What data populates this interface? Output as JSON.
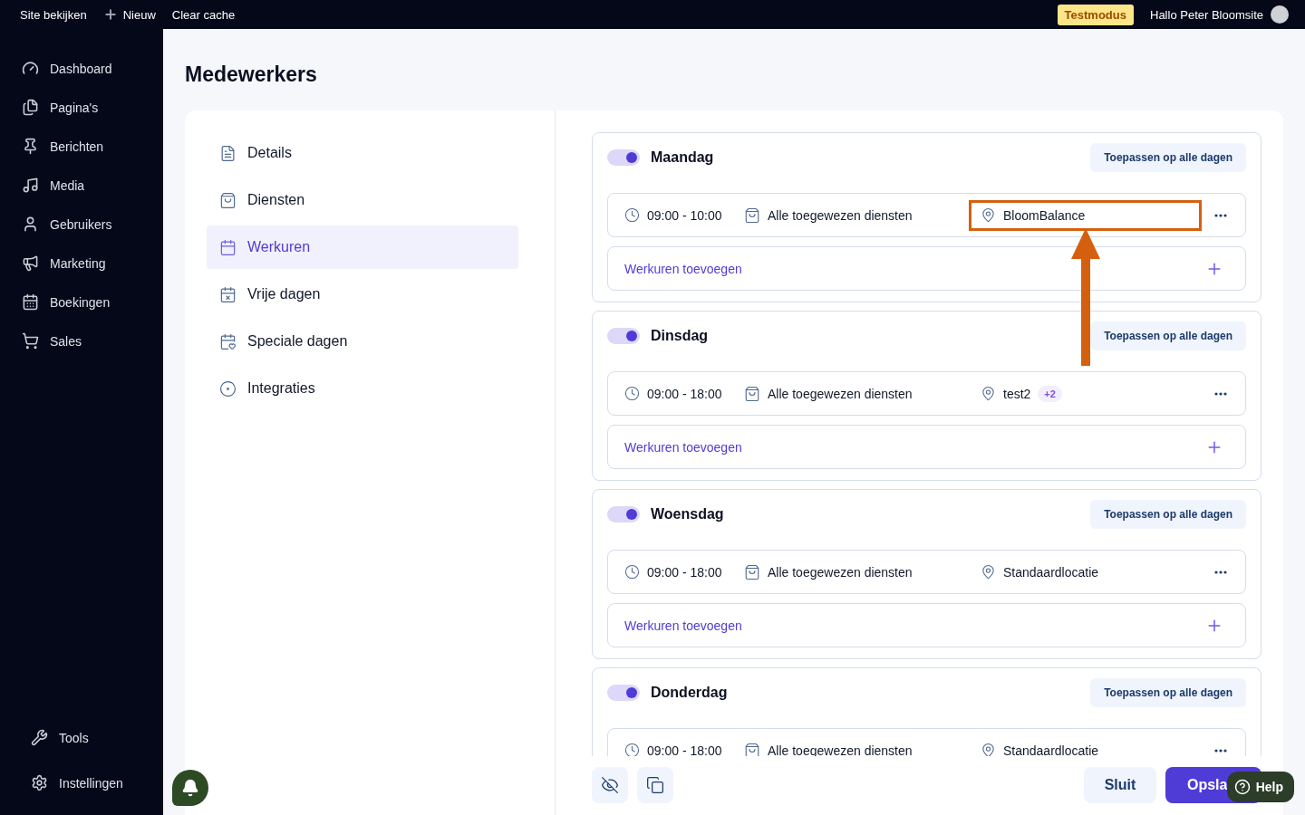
{
  "top_bar": {
    "links": [
      {
        "label": "Site bekijken",
        "kind": "plain"
      },
      {
        "label": "Nieuw",
        "kind": "new"
      },
      {
        "label": "Clear cache",
        "kind": "plain"
      }
    ],
    "badge": "Testmodus",
    "greeting": "Hallo Peter Bloomsite"
  },
  "sidebar": {
    "items": [
      {
        "label": "Dashboard"
      },
      {
        "label": "Pagina's"
      },
      {
        "label": "Berichten"
      },
      {
        "label": "Media"
      },
      {
        "label": "Gebruikers"
      },
      {
        "label": "Marketing"
      },
      {
        "label": "Boekingen"
      },
      {
        "label": "Sales"
      }
    ],
    "bottom_items": [
      {
        "label": "Tools"
      },
      {
        "label": "Instellingen"
      }
    ]
  },
  "page_title": "Medewerkers",
  "tabs": [
    {
      "label": "Details",
      "selected": false
    },
    {
      "label": "Diensten",
      "selected": false
    },
    {
      "label": "Werkuren",
      "selected": true
    },
    {
      "label": "Vrije dagen",
      "selected": false
    },
    {
      "label": "Speciale dagen",
      "selected": false
    },
    {
      "label": "Integraties",
      "selected": false
    }
  ],
  "days": [
    {
      "name": "Maandag",
      "on": true,
      "apply_button": "Toepassen op alle dagen",
      "slots": [
        {
          "time": "09:00 - 10:00",
          "services": "Alle toegewezen diensten",
          "location": "BloomBalance",
          "highlighted": true
        }
      ],
      "add_label": "Werkuren toevoegen"
    },
    {
      "name": "Dinsdag",
      "on": true,
      "apply_button": "Toepassen op alle dagen",
      "slots": [
        {
          "time": "09:00 - 18:00",
          "services": "Alle toegewezen diensten",
          "location": "test2",
          "extra": "+2",
          "highlighted": false
        }
      ],
      "add_label": "Werkuren toevoegen"
    },
    {
      "name": "Woensdag",
      "on": true,
      "apply_button": "Toepassen op alle dagen",
      "slots": [
        {
          "time": "09:00 - 18:00",
          "services": "Alle toegewezen diensten",
          "location": "Standaardlocatie",
          "highlighted": false
        }
      ],
      "add_label": "Werkuren toevoegen"
    },
    {
      "name": "Donderdag",
      "on": true,
      "apply_button": "Toepassen op alle dagen",
      "slots": [
        {
          "time": "09:00 - 18:00",
          "services": "Alle toegewezen diensten",
          "location": "Standaardlocatie",
          "highlighted": false
        }
      ]
    }
  ],
  "footer": {
    "close_button": "Sluit",
    "save_button": "Opsla"
  },
  "help_button": "Help"
}
